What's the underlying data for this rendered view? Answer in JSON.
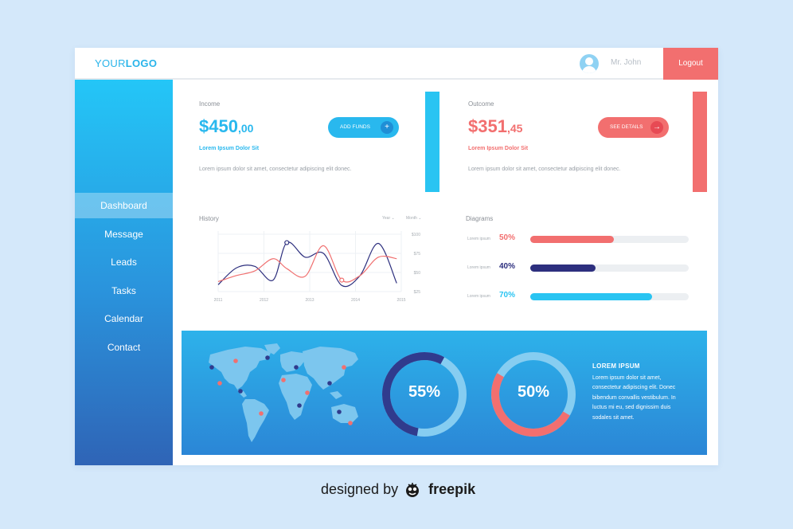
{
  "header": {
    "logo_light": "YOUR",
    "logo_bold": "LOGO",
    "username": "Mr. John",
    "logout_label": "Logout"
  },
  "sidebar": {
    "items": [
      {
        "label": "Dashboard",
        "active": true
      },
      {
        "label": "Message",
        "active": false
      },
      {
        "label": "Leads",
        "active": false
      },
      {
        "label": "Tasks",
        "active": false
      },
      {
        "label": "Calendar",
        "active": false
      },
      {
        "label": "Contact",
        "active": false
      }
    ]
  },
  "income": {
    "label": "Income",
    "amount": "$450",
    "cents": ",00",
    "sub": "Lorem Ipsum Dolor Sit",
    "desc": "Lorem ipsum dolor sit amet, consectetur adipiscing elit donec.",
    "button": "ADD FUNDS",
    "button_icon": "plus-icon",
    "color": "#29b8ee"
  },
  "outcome": {
    "label": "Outcome",
    "amount": "$351",
    "cents": ",45",
    "sub": "Lorem Ipsum Dolor Sit",
    "desc": "Lorem ipsum dolor sit amet, consectetur adipiscing elit donec.",
    "button": "SEE DETAILS",
    "button_icon": "arrow-right-icon",
    "color": "#f26f6f"
  },
  "history": {
    "title": "History",
    "filters": [
      "Year",
      "Month"
    ],
    "chart_data": {
      "type": "line",
      "x_ticks": [
        "2011",
        "2012",
        "2013",
        "2014",
        "2015"
      ],
      "y_ticks": [
        "$25",
        "$50",
        "$75",
        "$100"
      ],
      "ylim": [
        25,
        100
      ],
      "series": [
        {
          "color": "#2d2f7e",
          "x": [
            2011.0,
            2011.4,
            2011.8,
            2012.2,
            2012.5,
            2012.9,
            2013.3,
            2013.7,
            2014.1,
            2014.5,
            2014.9
          ],
          "y": [
            34,
            56,
            58,
            40,
            89,
            70,
            75,
            33,
            46,
            88,
            36
          ]
        },
        {
          "color": "#f07070",
          "x": [
            2011.0,
            2011.4,
            2011.8,
            2012.2,
            2012.5,
            2012.9,
            2013.3,
            2013.7,
            2014.1,
            2014.5,
            2014.9
          ],
          "y": [
            38,
            46,
            52,
            68,
            55,
            45,
            85,
            40,
            46,
            70,
            68
          ]
        }
      ]
    }
  },
  "diagrams": {
    "title": "Diagrams",
    "rows": [
      {
        "label": "Lorem ipsum",
        "pct_text": "50%",
        "value": 0.53,
        "color": "#f26f6f"
      },
      {
        "label": "Lorem ipsum",
        "pct_text": "40%",
        "value": 0.41,
        "color": "#2d2f7e"
      },
      {
        "label": "Lorem ipsum",
        "pct_text": "70%",
        "value": 0.77,
        "color": "#29c4f2"
      }
    ]
  },
  "rings": [
    {
      "text": "55%",
      "value": 0.55,
      "color": "#303b8d"
    },
    {
      "text": "50%",
      "value": 0.5,
      "color": "#f26f6f"
    }
  ],
  "info": {
    "title": "LOREM IPSUM",
    "body": "Lorem ipsum dolor sit amet, consectetur adipiscing elit. Donec bibendum convallis vestibulum. In luctus mi eu, sed dignissim duis sodales sit amet."
  },
  "credit": {
    "prefix": "designed by",
    "brand": "freepik"
  }
}
